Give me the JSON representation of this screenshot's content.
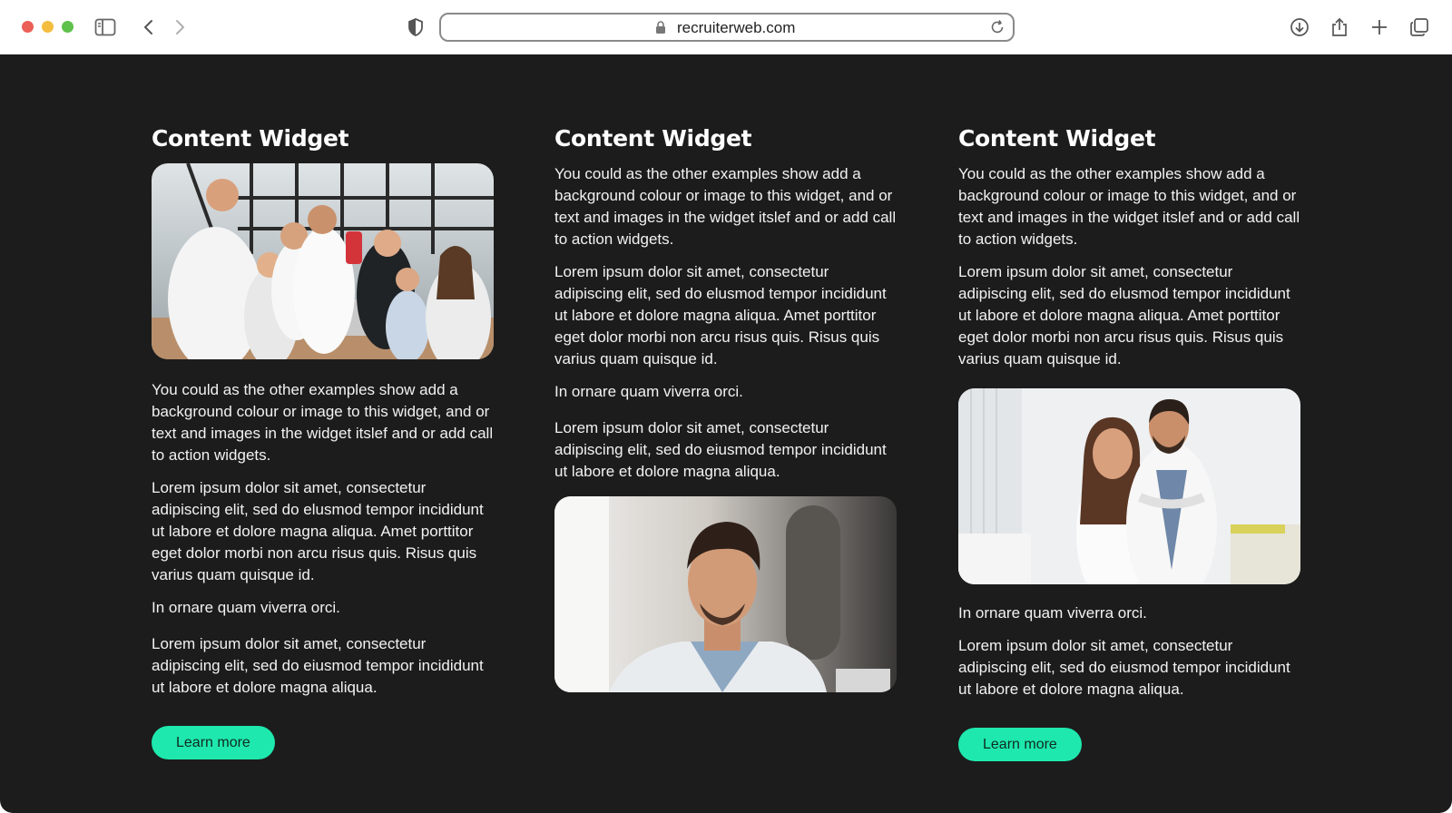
{
  "browser": {
    "url": "recruiterweb.com",
    "traffic_colors": [
      "#ec5f56",
      "#f4bd3f",
      "#5ec14b"
    ],
    "icons": [
      "sidebar-icon",
      "back-chevron-icon",
      "forward-chevron-icon",
      "privacy-shield-icon",
      "lock-icon",
      "reload-icon",
      "download-icon",
      "share-icon",
      "new-tab-plus-icon",
      "tabs-overview-icon"
    ]
  },
  "theme": {
    "page_background": "#1c1c1c",
    "accent": "#1ee8ad",
    "text": "#ffffff"
  },
  "widgets": [
    {
      "title": "Content Widget",
      "image": "team-office-photo",
      "paragraphs": [
        "You could as the other examples show add a background colour or image to this widget, and or text and images in the widget itslef and or add call to action widgets.",
        "Lorem ipsum dolor sit amet, consectetur adipiscing elit, sed do elusmod tempor incididunt ut labore et dolore magna aliqua. Amet porttitor eget dolor morbi non arcu risus quis. Risus quis varius quam quisque id.",
        "In ornare quam viverra orci.",
        "Lorem ipsum dolor sit amet, consectetur adipiscing elit, sed do eiusmod tempor incididunt ut labore et dolore magna aliqua."
      ],
      "cta": "Learn more"
    },
    {
      "title": "Content Widget",
      "image": "young-man-portrait-photo",
      "paragraphs": [
        "You could as the other examples show add a background colour or image to this widget, and or text and images in the widget itslef and or add call to action widgets.",
        "Lorem ipsum dolor sit amet, consectetur adipiscing elit, sed do elusmod tempor incididunt ut labore et dolore magna aliqua. Amet porttitor eget dolor morbi non arcu risus quis. Risus quis varius quam quisque id.",
        "In ornare quam viverra orci.",
        "Lorem ipsum dolor sit amet, consectetur adipiscing elit, sed do eiusmod tempor incididunt ut labore et dolore magna aliqua."
      ]
    },
    {
      "title": "Content Widget",
      "image": "doctors-photo",
      "paragraphs": [
        "You could as the other examples show add a background colour or image to this widget, and or text and images in the widget itslef and or add call to action widgets.",
        "Lorem ipsum dolor sit amet, consectetur adipiscing elit, sed do elusmod tempor incididunt ut labore et dolore magna aliqua. Amet porttitor eget dolor morbi non arcu risus quis. Risus quis varius quam quisque id.",
        "In ornare quam viverra orci.",
        "Lorem ipsum dolor sit amet, consectetur adipiscing elit, sed do eiusmod tempor incididunt ut labore et dolore magna aliqua."
      ],
      "cta": "Learn more"
    }
  ]
}
